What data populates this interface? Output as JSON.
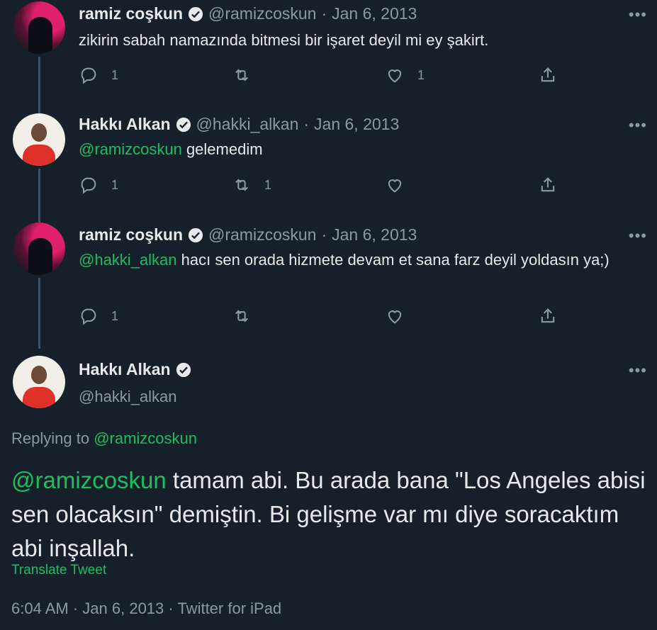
{
  "tweets": [
    {
      "name": "ramiz coşkun",
      "handle": "@ramizcoskun",
      "date": "Jan 6, 2013",
      "text": "zikirin sabah namazında bitmesi bir işaret deyil mi ey şakirt.",
      "mention": "",
      "reply_count": "1",
      "retweet_count": "",
      "like_count": "1"
    },
    {
      "name": "Hakkı Alkan",
      "handle": "@hakki_alkan",
      "date": "Jan 6, 2013",
      "mention": "@ramizcoskun",
      "text": " gelemedim",
      "reply_count": "1",
      "retweet_count": "1",
      "like_count": ""
    },
    {
      "name": "ramiz coşkun",
      "handle": "@ramizcoskun",
      "date": "Jan 6, 2013",
      "mention": "@hakki_alkan",
      "text": " hacı sen orada hizmete devam et sana farz deyil yoldasın ya;)",
      "reply_count": "1",
      "retweet_count": "",
      "like_count": ""
    }
  ],
  "main_tweet": {
    "name": "Hakkı Alkan",
    "handle": "@hakki_alkan",
    "replying_prefix": "Replying to ",
    "replying_to": "@ramizcoskun",
    "mention": "@ramizcoskun",
    "text": " tamam abi. Bu arada bana \"Los Angeles abisi sen olacaksın\" demiştin. Bi gelişme var mı diye soracaktım abi inşallah.",
    "translate_label": "Translate Tweet",
    "time": "6:04 AM",
    "date": "Jan 6, 2013",
    "source": "Twitter for iPad"
  },
  "ui": {
    "dot": "·",
    "more": "•••"
  },
  "colors": {
    "background": "#15202b",
    "mention": "#1fbd5f",
    "muted": "#8b98a5",
    "thread_line": "#3d5466"
  }
}
